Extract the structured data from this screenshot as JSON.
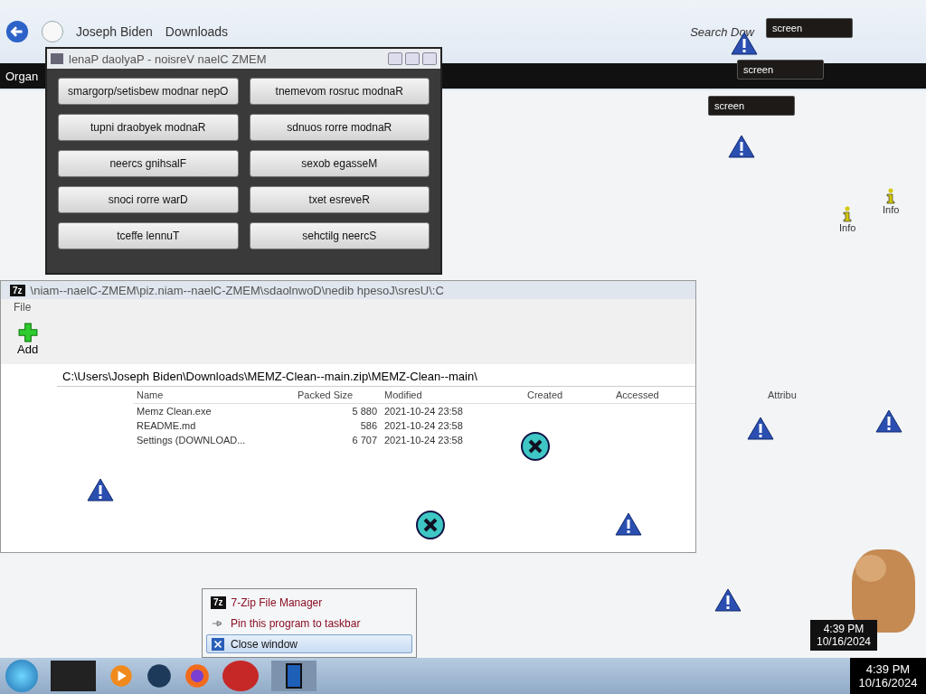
{
  "explorer": {
    "breadcrumb": [
      "Joseph Biden",
      "Downloads"
    ],
    "organize": "Organ",
    "search_placeholder": "Search Dow"
  },
  "memz_panel": {
    "title": "lenaP daolyaP - noisreV naelC ZMEM",
    "buttons": [
      "smargorp/setisbew modnar nepO",
      "tnemevom rosruc modnaR",
      "tupni draobyek modnaR",
      "sdnuos rorre modnaR",
      "neercs gnihsalF",
      "sexob egasseM",
      "snoci rorre warD",
      "txet esreveR",
      "tceffe lennuT",
      "sehctilg neercS"
    ]
  },
  "zip_window": {
    "logo": "7z",
    "title": "\\niam--naelC-ZMEM\\piz.niam--naelC-ZMEM\\sdaolnwoD\\nedib hpesoJ\\sresU\\:C",
    "menu": "File",
    "toolbar": "Add",
    "path": "C:\\Users\\Joseph Biden\\Downloads\\MEMZ-Clean--main.zip\\MEMZ-Clean--main\\",
    "columns": [
      "Name",
      "Packed Size",
      "Modified",
      "Created",
      "Accessed",
      "Attribu"
    ],
    "rows": [
      {
        "name": "Memz Clean.exe",
        "packed": "5 880",
        "modified": "2021-10-24 23:58"
      },
      {
        "name": "README.md",
        "packed": "586",
        "modified": "2021-10-24 23:58"
      },
      {
        "name": "Settings (DOWNLOAD...",
        "packed": "6 707",
        "modified": "2021-10-24 23:58"
      }
    ]
  },
  "overlay_buttons": [
    "screen",
    "screen",
    "screen"
  ],
  "info_labels": [
    "Info",
    "Info"
  ],
  "jump_list": {
    "items": [
      {
        "kind": "app",
        "icon_text": "7z",
        "label": "7-Zip File Manager",
        "selected": false
      },
      {
        "kind": "pin",
        "label": "Pin this program to taskbar",
        "selected": false
      },
      {
        "kind": "close",
        "label": "Close window",
        "selected": true
      }
    ]
  },
  "clock_popup": {
    "time": "4:39 PM",
    "date": "10/16/2024"
  },
  "taskbar": {
    "time": "4:39 PM",
    "date": "10/16/2024"
  }
}
